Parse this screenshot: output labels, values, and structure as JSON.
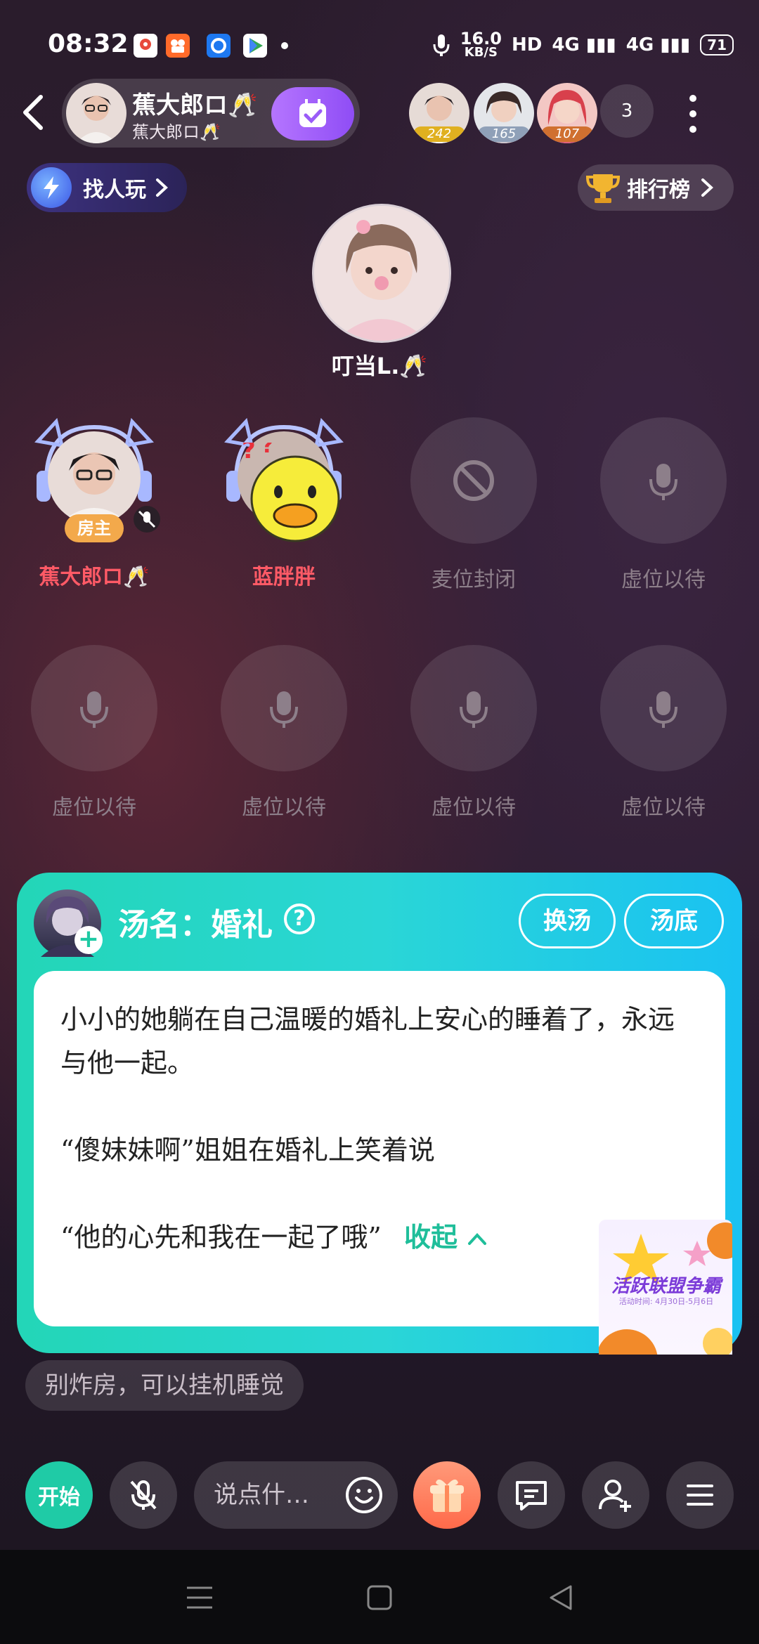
{
  "status_bar": {
    "time": "08:32",
    "net_speed_value": "16.0",
    "net_speed_unit": "KB/S",
    "hd": "HD",
    "signal1": "4G",
    "signal2": "4G",
    "battery": "71"
  },
  "header": {
    "room_title": "蕉大郎ロ🥂",
    "room_subtitle": "蕉大郎ロ🥂",
    "online_users": [
      {
        "badge": "242",
        "color": "#e0b020"
      },
      {
        "badge": "165",
        "color": "#8fa0b8"
      },
      {
        "badge": "107",
        "color": "#d07030"
      }
    ],
    "online_count": "3",
    "find_label": "找人玩",
    "rank_label": "排行榜"
  },
  "host": {
    "name": "叮当L.🥂"
  },
  "seats": {
    "owner_tag": "房主",
    "row1": [
      "蕉大郎ロ🥂",
      "蓝胖胖",
      "麦位封闭",
      "虚位以待"
    ],
    "row2": [
      "虚位以待",
      "虚位以待",
      "虚位以待",
      "虚位以待"
    ]
  },
  "soup": {
    "title": "汤名：婚礼",
    "help": "?",
    "change_btn": "换汤",
    "answer_btn": "汤底",
    "lines": [
      "小小的她躺在自己温暖的婚礼上安心的睡着了，永远与他一起。",
      "“傻妹妹啊”姐姐在婚礼上笑着说",
      "“他的心先和我在一起了哦”"
    ],
    "collapse": "收起",
    "promo_title": "活跃联盟争霸",
    "promo_sub": "活动时间: 4月30日-5月6日"
  },
  "notice": "别炸房，可以挂机睡觉",
  "bottom": {
    "start": "开始",
    "input_placeholder": "说点什…"
  },
  "colors": {
    "accent_teal": "#1fcba6",
    "accent_purple": "#9a5cf8",
    "seat_name_red": "#ff5a66"
  }
}
